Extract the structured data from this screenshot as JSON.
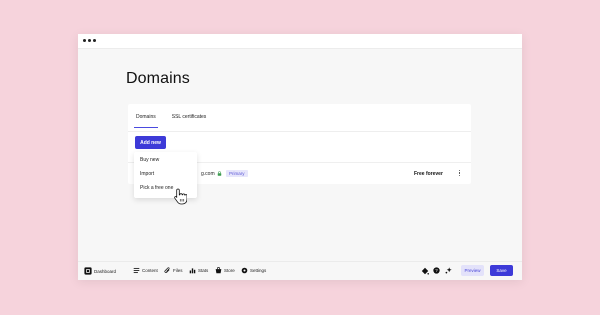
{
  "page": {
    "title": "Domains"
  },
  "tabs": [
    {
      "label": "Domains",
      "active": true
    },
    {
      "label": "SSL certificates",
      "active": false
    }
  ],
  "actions": {
    "add_new_label": "Add new"
  },
  "dropdown": {
    "items": [
      {
        "label": "Buy new"
      },
      {
        "label": "Import"
      },
      {
        "label": "Pick a free one"
      }
    ]
  },
  "domain_row": {
    "name_visible_fragment": "g.com",
    "badge": "Primary",
    "plan": "Free forever",
    "lock_icon": "lock-icon",
    "menu_icon": "more-vertical-icon"
  },
  "bottom_nav": [
    {
      "label": "Dashboard",
      "icon": "dashboard-icon"
    },
    {
      "label": "Content",
      "icon": "content-icon"
    },
    {
      "label": "Files",
      "icon": "paperclip-icon"
    },
    {
      "label": "Stats",
      "icon": "stats-icon"
    },
    {
      "label": "Store",
      "icon": "store-icon"
    },
    {
      "label": "Settings",
      "icon": "gear-icon"
    }
  ],
  "bottom_right": {
    "icons": [
      "paint-bucket-icon",
      "help-icon",
      "sparkle-icon"
    ],
    "preview_label": "Preview",
    "save_label": "Save"
  },
  "colors": {
    "background": "#f6d3dc",
    "accent": "#3d3ad8",
    "accent_light": "#e3e2fa"
  }
}
